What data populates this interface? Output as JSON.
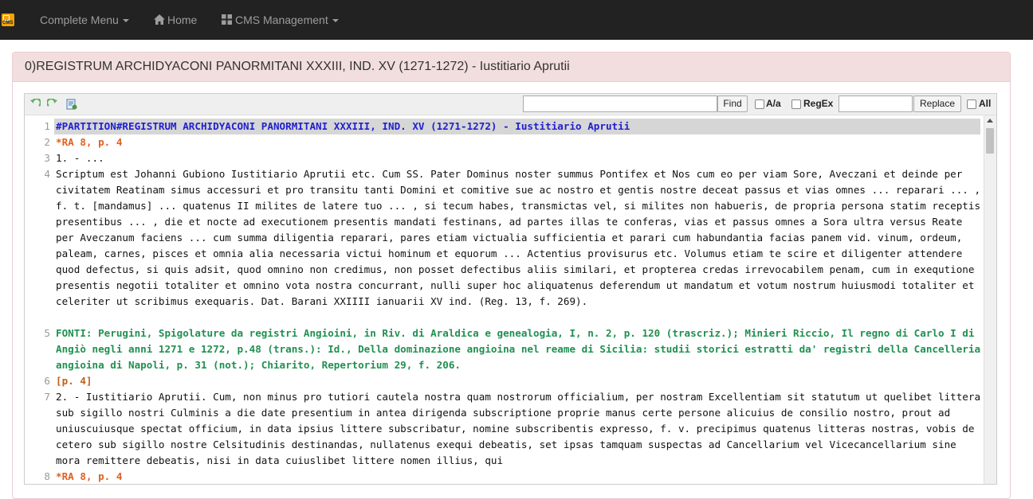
{
  "navbar": {
    "logo_text": "CMS",
    "complete_menu": "Complete Menu",
    "home": "Home",
    "cms_management": "CMS Management"
  },
  "panel": {
    "title": "0)REGISTRUM ARCHIDYACONI PANORMITANI XXXIII, IND. XV (1271-1272) - Iustitiario Aprutii"
  },
  "toolbar": {
    "find_value": "",
    "find_label": "Find",
    "case_label": "A/a",
    "regex_label": "RegEx",
    "replace_value": "",
    "replace_label": "Replace",
    "all_label": "All"
  },
  "lines": [
    {
      "num": "1",
      "type": "hdr",
      "text": "#PARTITION#REGISTRUM ARCHIDYACONI PANORMITANI XXXIII, IND. XV (1271-1272) - Iustitiario Aprutii"
    },
    {
      "num": "2",
      "type": "ref",
      "text": "*RA 8, p. 4"
    },
    {
      "num": "3",
      "type": "plain",
      "text": "1. - ..."
    },
    {
      "num": "4",
      "type": "plain",
      "text": "Scriptum est Johanni Gubiono Iustitiario Aprutii etc. Cum SS. Pater Dominus noster summus Pontifex et Nos cum eo per viam Sore, Aveczani et deinde per civitatem Reatinam simus accessuri et pro transitu tanti Domini et comitive sue ac nostro et gentis nostre deceat passus et vias omnes ... reparari ... , f. t. [mandamus] ... quatenus II milites de latere tuo ... , si tecum habes, transmictas vel, si milites non habueris, de propria persona statim receptis presentibus ... , die et nocte ad executionem presentis mandati festinans, ad partes illas te conferas, vias et passus omnes a Sora ultra versus Reate per Aveczanum faciens ... cum summa diligentia reparari, pares etiam victualia sufficientia et parari cum habundantia facias panem vid. vinum, ordeum, paleam, carnes, pisces et omnia alia necessaria victui hominum et equorum ... Actentius provisurus etc. Volumus etiam te scire et diligenter attendere quod defectus, si quis adsit, quod omnino non credimus, non posset defectibus aliis similari, et propterea credas irrevocabilem penam, cum in exequtione presentis negotii totaliter et omnino vota nostra concurrant, nulli super hoc aliquatenus deferendum ut mandatum et votum nostrum huiusmodi totaliter et celeriter ut scribimus exequaris. Dat. Barani XXIIII ianuarii XV ind. (Reg. 13, f. 269)."
    },
    {
      "num": "5",
      "type": "fonti",
      "text": "FONTI: Perugini, Spigolature da registri Angioini, in Riv. di Araldica e genealogia, I, n. 2, p. 120 (trascriz.); Minieri Riccio, Il regno di Carlo I di Angiò negli anni 1271 e 1272, p.48 (trans.): Id., Della dominazione angioina nel reame di Sicilia: studii storici estratti da' registri della Cancelleria angioina di Napoli, p. 31 (not.); Chiarito, Repertorium 29, f. 206."
    },
    {
      "num": "6",
      "type": "page",
      "text": "[p. 4]"
    },
    {
      "num": "7",
      "type": "plain",
      "text": "2. - Iustitiario Aprutii. Cum, non minus pro tutiori cautela nostra quam nostrorum officialium, per nostram Excellentiam sit statutum ut quelibet littera sub sigillo nostri Culminis a die date presentium in antea dirigenda subscriptione proprie manus certe persone alicuius de consilio nostro, prout ad uniuscuiusque spectat officium, in data ipsius littere subscribatur, nomine subscribentis expresso, f. v. precipimus quatenus litteras nostras, vobis de cetero sub sigillo nostre Celsitudinis destinandas, nullatenus exequi debeatis, set ipsas tamquam suspectas ad Cancellarium vel Vicecancellarium sine mora remittere debeatis, nisi in data cuiuslibet littere nomen illius, qui"
    },
    {
      "num": "8",
      "type": "ref",
      "text": "*RA 8, p. 4"
    }
  ]
}
